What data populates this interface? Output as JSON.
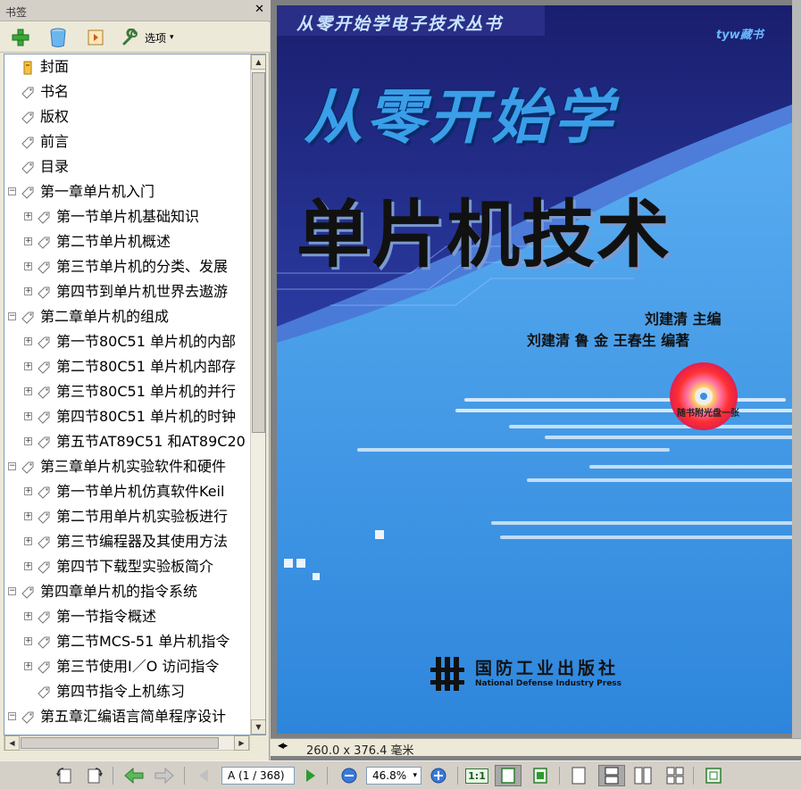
{
  "bookmarks_panel": {
    "title": "书签",
    "close_symbol": "✕",
    "toolbar": {
      "new_bookmark_icon": "plus-icon",
      "delete_icon": "trash-icon",
      "expand_icon": "expand-current-icon",
      "options_label": "选项",
      "options_arrow": "▾"
    },
    "items": [
      {
        "label": "封面",
        "level": 0,
        "expander": "",
        "icon": "bookmark-yellow"
      },
      {
        "label": "书名",
        "level": 0,
        "expander": "",
        "icon": "bookmark"
      },
      {
        "label": "版权",
        "level": 0,
        "expander": "",
        "icon": "bookmark"
      },
      {
        "label": "前言",
        "level": 0,
        "expander": "",
        "icon": "bookmark"
      },
      {
        "label": "目录",
        "level": 0,
        "expander": "",
        "icon": "bookmark"
      },
      {
        "label": "第一章单片机入门",
        "level": 0,
        "expander": "−",
        "icon": "bookmark"
      },
      {
        "label": "第一节单片机基础知识",
        "level": 1,
        "expander": "+",
        "icon": "bookmark"
      },
      {
        "label": "第二节单片机概述",
        "level": 1,
        "expander": "+",
        "icon": "bookmark"
      },
      {
        "label": "第三节单片机的分类、发展",
        "level": 1,
        "expander": "+",
        "icon": "bookmark"
      },
      {
        "label": "第四节到单片机世界去遨游",
        "level": 1,
        "expander": "+",
        "icon": "bookmark"
      },
      {
        "label": "第二章单片机的组成",
        "level": 0,
        "expander": "−",
        "icon": "bookmark"
      },
      {
        "label": "第一节80C51 单片机的内部",
        "level": 1,
        "expander": "+",
        "icon": "bookmark"
      },
      {
        "label": "第二节80C51 单片机内部存",
        "level": 1,
        "expander": "+",
        "icon": "bookmark"
      },
      {
        "label": "第三节80C51 单片机的并行",
        "level": 1,
        "expander": "+",
        "icon": "bookmark"
      },
      {
        "label": "第四节80C51 单片机的时钟",
        "level": 1,
        "expander": "+",
        "icon": "bookmark"
      },
      {
        "label": "第五节AT89C51 和AT89C20",
        "level": 1,
        "expander": "+",
        "icon": "bookmark"
      },
      {
        "label": "第三章单片机实验软件和硬件",
        "level": 0,
        "expander": "−",
        "icon": "bookmark"
      },
      {
        "label": "第一节单片机仿真软件Keil",
        "level": 1,
        "expander": "+",
        "icon": "bookmark"
      },
      {
        "label": "第二节用单片机实验板进行",
        "level": 1,
        "expander": "+",
        "icon": "bookmark"
      },
      {
        "label": "第三节编程器及其使用方法",
        "level": 1,
        "expander": "+",
        "icon": "bookmark"
      },
      {
        "label": "第四节下载型实验板简介",
        "level": 1,
        "expander": "+",
        "icon": "bookmark"
      },
      {
        "label": "第四章单片机的指令系统",
        "level": 0,
        "expander": "−",
        "icon": "bookmark"
      },
      {
        "label": "第一节指令概述",
        "level": 1,
        "expander": "+",
        "icon": "bookmark"
      },
      {
        "label": "第二节MCS-51 单片机指令",
        "level": 1,
        "expander": "+",
        "icon": "bookmark"
      },
      {
        "label": "第三节使用I／O 访问指令",
        "level": 1,
        "expander": "+",
        "icon": "bookmark"
      },
      {
        "label": "第四节指令上机练习",
        "level": 1,
        "expander": "",
        "icon": "bookmark"
      },
      {
        "label": "第五章汇编语言简单程序设计",
        "level": 0,
        "expander": "−",
        "icon": "bookmark"
      }
    ]
  },
  "document": {
    "page_size_text": "260.0 x 376.4 毫米",
    "cover": {
      "series": "从零开始学电子技术丛书",
      "tag": "tyw藏书",
      "title_line1": "从零开始学",
      "title_line2": "单片机技术",
      "editor": "刘建清  主编",
      "authors": "刘建清  鲁  金  王春生  编著",
      "cd_label": "随书附光盘一张",
      "publisher_cn": "国防工业出版社",
      "publisher_en": "National Defense Industry Press"
    }
  },
  "bottom_toolbar": {
    "page_field": "A (1 / 368)",
    "zoom_field": "46.8%",
    "fit_label": "1:1"
  },
  "colors": {
    "panel_bg": "#ece9d8",
    "cover_blue": "#3a8fe0",
    "cover_dark": "#1a1e6e",
    "accent_green": "#2e9a2e"
  }
}
